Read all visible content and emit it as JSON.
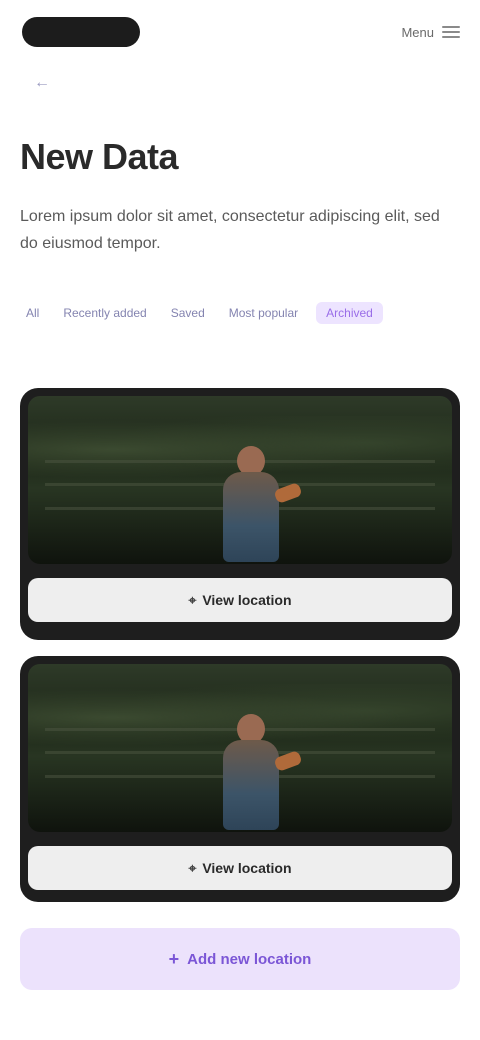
{
  "header": {
    "logo_text": "",
    "menu_label": "Menu"
  },
  "back_link": {
    "label": "←"
  },
  "page": {
    "title": "New Data",
    "description": "Lorem ipsum dolor sit amet, consectetur adipiscing elit, sed do eiusmod tempor."
  },
  "filters": [
    {
      "label": "All"
    },
    {
      "label": "Recently added"
    },
    {
      "label": "Saved"
    },
    {
      "label": "Most popular"
    },
    {
      "label": "Archived",
      "active": true
    }
  ],
  "cards": [
    {
      "image_alt": "person outdoors",
      "button_label": "View location"
    },
    {
      "image_alt": "person outdoors",
      "button_label": "View location"
    }
  ],
  "cta": {
    "label": "Add new location"
  },
  "colors": {
    "accent": "#9a6ee8",
    "accent_bg": "#ede4ff",
    "card_bg": "#1e1e1e"
  }
}
